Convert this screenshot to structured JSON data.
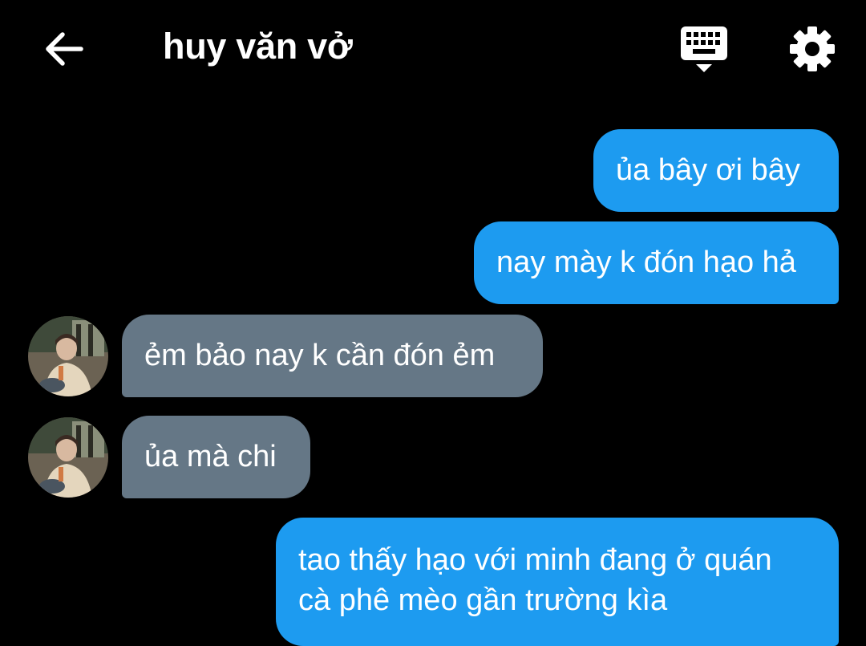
{
  "header": {
    "title": "huy văn vở",
    "back_icon": "arrow-left-icon",
    "keyboard_icon": "keyboard-icon",
    "settings_icon": "gear-icon"
  },
  "colors": {
    "background": "#000000",
    "sent_bubble": "#1d9bf0",
    "received_bubble": "#657786",
    "text": "#ffffff"
  },
  "messages": [
    {
      "side": "sent",
      "lines": [
        "ủa bây ơi bây"
      ]
    },
    {
      "side": "sent",
      "lines": [
        "nay mày k đón hạo hả"
      ]
    },
    {
      "side": "received",
      "lines": [
        "ẻm bảo nay k cần đón ẻm"
      ]
    },
    {
      "side": "received",
      "lines": [
        "ủa mà chi"
      ]
    },
    {
      "side": "sent",
      "lines": [
        "tao thấy hạo với minh đang ở quán",
        "cà phê mèo gần trường kìa"
      ]
    }
  ]
}
